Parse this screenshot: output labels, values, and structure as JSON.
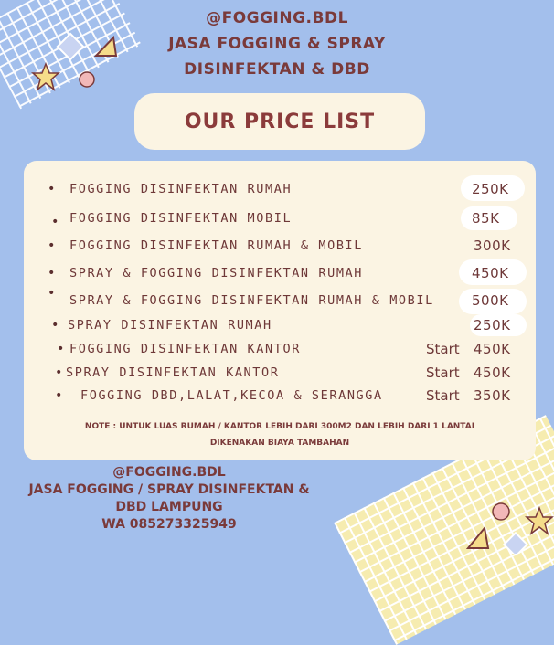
{
  "header": {
    "handle": "@FOGGING.BDL",
    "line1": "JASA FOGGING & SPRAY",
    "line2": "DISINFEKTAN & DBD"
  },
  "title": "OUR PRICE LIST",
  "items": [
    {
      "label": "FOGGING DISINFEKTAN RUMAH",
      "start": "",
      "price": "250K"
    },
    {
      "label": "FOGGING DISINFEKTAN MOBIL",
      "start": "",
      "price": "85K"
    },
    {
      "label": "FOGGING DISINFEKTAN RUMAH & MOBIL",
      "start": "",
      "price": "300K"
    },
    {
      "label": "SPRAY & FOGGING DISINFEKTAN RUMAH",
      "start": "",
      "price": "450K"
    },
    {
      "label": "SPRAY & FOGGING DISINFEKTAN RUMAH & MOBIL",
      "start": "",
      "price": "500K"
    },
    {
      "label": "SPRAY DISINFEKTAN RUMAH",
      "start": "",
      "price": "250K"
    },
    {
      "label": "FOGGING DISINFEKTAN KANTOR",
      "start": "Start",
      "price": "450K"
    },
    {
      "label": "SPRAY DISINFEKTAN KANTOR",
      "start": "Start",
      "price": "450K"
    },
    {
      "label": "FOGGING DBD,LALAT,KECOA & SERANGGA",
      "start": "Start",
      "price": "350K"
    }
  ],
  "note": {
    "line1": "NOTE : UNTUK LUAS RUMAH / KANTOR LEBIH DARI 300M2 DAN LEBIH DARI 1 LANTAI",
    "line2": "DIKENAKAN BIAYA TAMBAHAN"
  },
  "footer": {
    "handle": "@FOGGING.BDL",
    "line1": "JASA FOGGING / SPRAY DISINFEKTAN &",
    "line2": "DBD LAMPUNG",
    "phone": "WA 085273325949"
  },
  "colors": {
    "background": "#a3bfec",
    "card": "#fbf4e3",
    "text": "#7a3a3a",
    "grid_yellow": "#f6ecb0"
  },
  "decorations": [
    "star-icon",
    "diamond-icon",
    "triangle-icon",
    "circle-icon"
  ]
}
